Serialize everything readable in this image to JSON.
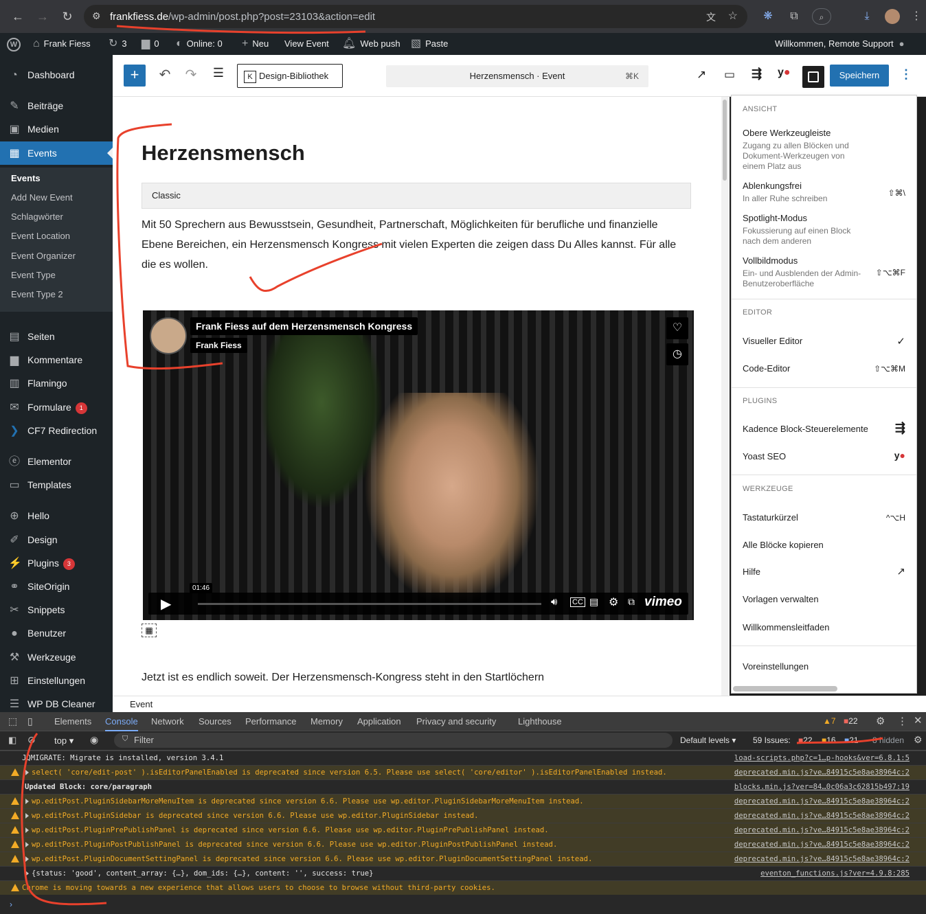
{
  "browser": {
    "url_domain": "frankfiess.de",
    "url_path": "/wp-admin/post.php?post=23103&action=edit"
  },
  "adminbar": {
    "site_name": "Frank Fiess",
    "updates": "3",
    "comments": "0",
    "online": "Online: 0",
    "new": "Neu",
    "view": "View Event",
    "web_push": "Web push",
    "paste": "Paste",
    "greeting": "Willkommen, Remote Support"
  },
  "sidebar": {
    "items": [
      {
        "label": "Dashboard",
        "icon": "dashboard-icon"
      },
      {
        "label": "Beiträge",
        "icon": "pin-icon"
      },
      {
        "label": "Medien",
        "icon": "media-icon"
      },
      {
        "label": "Events",
        "icon": "calendar-icon"
      },
      {
        "label": "Seiten",
        "icon": "page-icon"
      },
      {
        "label": "Kommentare",
        "icon": "comment-icon"
      },
      {
        "label": "Flamingo",
        "icon": "flamingo-icon"
      },
      {
        "label": "Formulare",
        "icon": "mail-icon",
        "badge": "1"
      },
      {
        "label": "CF7 Redirection",
        "icon": "redirect-icon"
      },
      {
        "label": "Elementor",
        "icon": "elementor-icon"
      },
      {
        "label": "Templates",
        "icon": "folder-icon"
      },
      {
        "label": "Hello",
        "icon": "plus-circle-icon"
      },
      {
        "label": "Design",
        "icon": "brush-icon"
      },
      {
        "label": "Plugins",
        "icon": "plug-icon",
        "badge": "3"
      },
      {
        "label": "SiteOrigin",
        "icon": "siteorigin-icon"
      },
      {
        "label": "Snippets",
        "icon": "scissors-icon"
      },
      {
        "label": "Benutzer",
        "icon": "user-icon"
      },
      {
        "label": "Werkzeuge",
        "icon": "wrench-icon"
      },
      {
        "label": "Einstellungen",
        "icon": "settings-icon"
      },
      {
        "label": "WP DB Cleaner",
        "icon": "database-icon"
      }
    ],
    "submenu": [
      "Events",
      "Add New Event",
      "Schlagwörter",
      "Event Location",
      "Event Organizer",
      "Event Type",
      "Event Type 2"
    ]
  },
  "toolbar": {
    "design_library": "Design-Bibliothek",
    "doc_title": "Herzensmensch · Event",
    "shortcut": "⌘K",
    "save": "Speichern"
  },
  "content": {
    "title": "Herzensmensch",
    "classic_label": "Classic",
    "paragraph": "Mit 50 Sprechern aus Bewusstsein, Gesundheit, Partnerschaft, Möglichkeiten für berufliche und finanzielle Ebene Bereichen, ein Herzensmensch Kongress mit vielen Experten die zeigen dass Du Alles kannst. Für alle die es wollen.",
    "video_title": "Frank Fiess auf dem Herzensmensch Kongress",
    "video_author": "Frank Fiess",
    "video_time": "01:46",
    "video_brand": "vimeo",
    "paragraph2": "Jetzt ist es endlich soweit. Der Herzensmensch-Kongress steht in den Startlöchern"
  },
  "breadcrumb": "Event",
  "options_menu": {
    "groups": [
      {
        "title": "Ansicht"
      },
      {
        "title": "Editor"
      },
      {
        "title": "Plugins"
      },
      {
        "title": "Werkzeuge"
      }
    ],
    "view_items": [
      {
        "label": "Obere Werkzeugleiste",
        "desc": "Zugang zu allen Blöcken und Dokument-Werkzeugen von einem Platz aus",
        "shortcut": ""
      },
      {
        "label": "Ablenkungsfrei",
        "desc": "In aller Ruhe schreiben",
        "shortcut": "⇧⌘\\"
      },
      {
        "label": "Spotlight-Modus",
        "desc": "Fokussierung auf einen Block nach dem anderen",
        "shortcut": ""
      },
      {
        "label": "Vollbildmodus",
        "desc": "Ein- und Ausblenden der Admin-Benutzeroberfläche",
        "shortcut": "⇧⌥⌘F"
      }
    ],
    "editor_items": [
      {
        "label": "Visueller Editor",
        "shortcut": "✓"
      },
      {
        "label": "Code-Editor",
        "shortcut": "⇧⌥⌘M"
      }
    ],
    "plugin_items": [
      "Kadence Block-Steuerelemente",
      "Yoast SEO"
    ],
    "tool_items": [
      {
        "label": "Tastaturkürzel",
        "shortcut": "^⌥H"
      },
      {
        "label": "Alle Blöcke kopieren",
        "shortcut": ""
      },
      {
        "label": "Hilfe",
        "shortcut": "↗"
      },
      {
        "label": "Vorlagen verwalten",
        "shortcut": ""
      },
      {
        "label": "Willkommensleitfaden",
        "shortcut": ""
      }
    ],
    "preferences": "Voreinstellungen"
  },
  "devtools": {
    "tabs": [
      "Elements",
      "Console",
      "Network",
      "Sources",
      "Performance",
      "Memory",
      "Application",
      "Privacy and security",
      "Lighthouse"
    ],
    "warn_count": "7",
    "error_count": "22",
    "context": "top",
    "filter_placeholder": "Filter",
    "levels": "Default levels",
    "issues_label": "59 Issues:",
    "issues_err": "22",
    "issues_warn": "16",
    "issues_info": "21",
    "hidden": "8 hidden",
    "logs": [
      {
        "type": "info",
        "msg": "JQMIGRATE: Migrate is installed, version 3.4.1",
        "src": "load-scripts.php?c=1…p-hooks&ver=6.8.1:5"
      },
      {
        "type": "warn",
        "msg": "select( 'core/edit-post' ).isEditorPanelEnabled is deprecated since version 6.5. Please use select( 'core/editor' ).isEditorPanelEnabled instead.",
        "src": "deprecated.min.js?ve…84915c5e8ae38964c:2"
      },
      {
        "type": "info",
        "msg": "Updated Block: core/paragraph",
        "src": "blocks.min.js?ver=84…0c06a3c62815b497:19"
      },
      {
        "type": "warn",
        "msg": "wp.editPost.PluginSidebarMoreMenuItem is deprecated since version 6.6. Please use wp.editor.PluginSidebarMoreMenuItem instead.",
        "src": "deprecated.min.js?ve…84915c5e8ae38964c:2"
      },
      {
        "type": "warn",
        "msg": "wp.editPost.PluginSidebar is deprecated since version 6.6. Please use wp.editor.PluginSidebar instead.",
        "src": "deprecated.min.js?ve…84915c5e8ae38964c:2"
      },
      {
        "type": "warn",
        "msg": "wp.editPost.PluginPrePublishPanel is deprecated since version 6.6. Please use wp.editor.PluginPrePublishPanel instead.",
        "src": "deprecated.min.js?ve…84915c5e8ae38964c:2"
      },
      {
        "type": "warn",
        "msg": "wp.editPost.PluginPostPublishPanel is deprecated since version 6.6. Please use wp.editor.PluginPostPublishPanel instead.",
        "src": "deprecated.min.js?ve…84915c5e8ae38964c:2"
      },
      {
        "type": "warn",
        "msg": "wp.editPost.PluginDocumentSettingPanel is deprecated since version 6.6. Please use wp.editor.PluginDocumentSettingPanel instead.",
        "src": "deprecated.min.js?ve…84915c5e8ae38964c:2"
      },
      {
        "type": "info",
        "msg": "{status: 'good', content_array: {…}, dom_ids: {…}, content: '', success: true}",
        "src": "eventon_functions.js?ver=4.9.8:285"
      },
      {
        "type": "warn",
        "msg": "Chrome is moving towards a new experience that allows users to choose to browse without third-party cookies.",
        "src": ""
      }
    ]
  }
}
